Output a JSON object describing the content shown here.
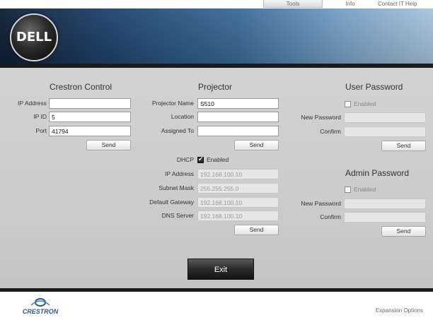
{
  "nav": {
    "tools": "Tools",
    "info": "Info",
    "contact": "Contact IT Help"
  },
  "header": {
    "logo_text": "DELL"
  },
  "crestron": {
    "title": "Crestron Control",
    "ip_address_label": "IP Address",
    "ip_address_value": "",
    "ip_id_label": "IP ID",
    "ip_id_value": "5",
    "port_label": "Port",
    "port_value": "41794",
    "send_label": "Send"
  },
  "projector": {
    "title": "Projector",
    "name_label": "Projector Name",
    "name_value": "S510",
    "location_label": "Location",
    "location_value": "",
    "assigned_label": "Assigned To",
    "assigned_value": "",
    "send_label": "Send",
    "dhcp_label": "DHCP",
    "dhcp_enabled_label": "Enabled",
    "dhcp_checked": true,
    "ip_label": "IP Address",
    "ip_value": "192.168.100.10",
    "subnet_label": "Subnet Mask",
    "subnet_value": "255.255.255.0",
    "gateway_label": "Default Gateway",
    "gateway_value": "192.168.100.10",
    "dns_label": "DNS Server",
    "dns_value": "192.168.100.10",
    "send2_label": "Send"
  },
  "user_password": {
    "title": "User Password",
    "enabled_label": "Enabled",
    "new_label": "New Password",
    "new_value": "",
    "confirm_label": "Confirm",
    "confirm_value": "",
    "send_label": "Send"
  },
  "admin_password": {
    "title": "Admin Password",
    "enabled_label": "Enabled",
    "new_label": "New Password",
    "new_value": "",
    "confirm_label": "Confirm",
    "confirm_value": "",
    "send_label": "Send"
  },
  "exit_label": "Exit",
  "footer": {
    "brand": "CRESTRON",
    "expansion": "Expansion Options"
  },
  "colors": {
    "header_dark": "#0f1f34",
    "header_light": "#a9c4dc",
    "panel": "#cccccc",
    "exit_button": "#1e1e1e"
  }
}
